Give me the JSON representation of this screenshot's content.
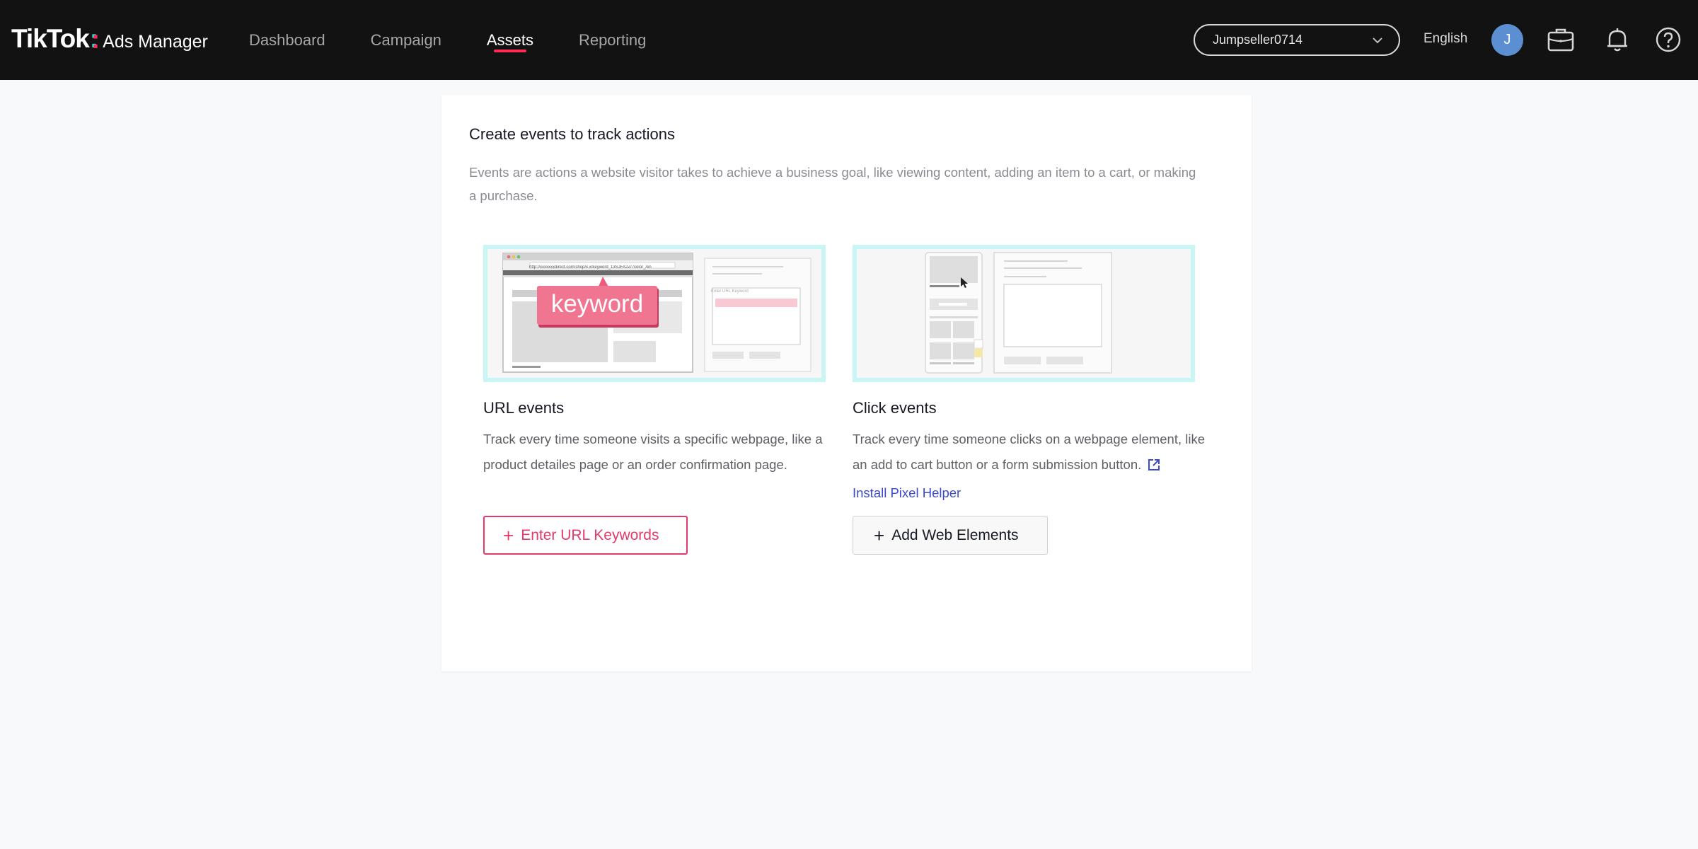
{
  "app": {
    "logo_main": "TikTok",
    "logo_colon": ":",
    "logo_sub": "Ads Manager",
    "accent": "#fe2c55",
    "accent_secondary": "#25f4ee"
  },
  "nav": {
    "items": [
      {
        "label": "Dashboard",
        "active": false
      },
      {
        "label": "Campaign",
        "active": false
      },
      {
        "label": "Assets",
        "active": true
      },
      {
        "label": "Reporting",
        "active": false
      }
    ]
  },
  "header": {
    "account": "Jumpseller0714",
    "language": "English",
    "avatar_initial": "J",
    "icons": [
      "briefcase-icon",
      "bell-icon",
      "help-icon"
    ]
  },
  "card": {
    "title": "Create events to track actions",
    "description": "Events are actions a website visitor takes to achieve a business goal, like viewing content, adding an item to a cart, or making a purchase."
  },
  "url_events": {
    "title": "URL events",
    "description": "Track every time someone visits a specific webpage, like a product detailes page or an order confirmation page.",
    "button_label": "Enter URL Keywords",
    "illustration": {
      "keyword_label": "keyword",
      "url_text": "http://xxxxxxxdirect.com/shop/x.x/keyword_13SJFA2Z/7color_/en",
      "form_label": "Enter URL Keyword"
    }
  },
  "click_events": {
    "title": "Click events",
    "description": "Track every time someone clicks on a webpage element, like an add to cart button or a form submission button.",
    "link_label": "Install Pixel Helper",
    "button_label": "Add Web Elements"
  }
}
